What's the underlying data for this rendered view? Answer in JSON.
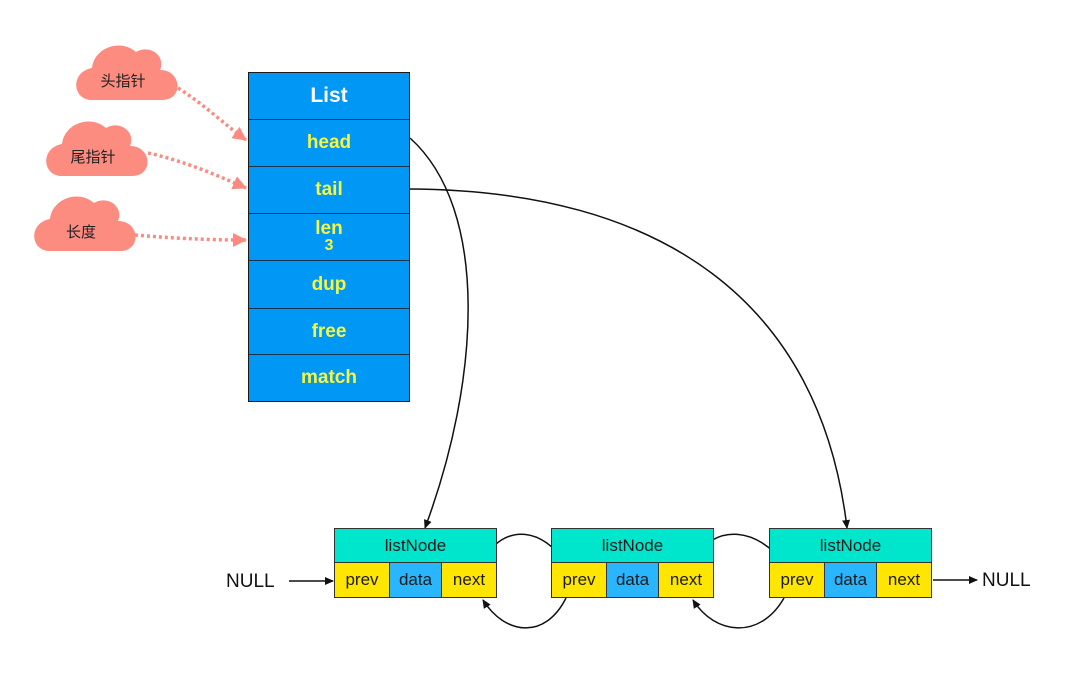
{
  "diagram": {
    "type": "redis-linked-list-structure",
    "colors": {
      "list_fill": "#0097f5",
      "list_title_text": "#ffffff",
      "list_field_text": "#f5f542",
      "cloud_fill": "#fc8b80",
      "pointer_arrow": "#fb8b80",
      "node_header": "#00e6cc",
      "node_pointer_field": "#ffe600",
      "node_data_field": "#29b6ff",
      "edge": "#111111"
    },
    "annotations": [
      {
        "label": "头指针",
        "target": "head"
      },
      {
        "label": "尾指针",
        "target": "tail"
      },
      {
        "label": "长度",
        "target": "len"
      }
    ],
    "list": {
      "title": "List",
      "fields": [
        {
          "name": "head"
        },
        {
          "name": "tail"
        },
        {
          "name": "len",
          "value": "3"
        },
        {
          "name": "dup"
        },
        {
          "name": "free"
        },
        {
          "name": "match"
        }
      ]
    },
    "nodes": [
      {
        "title": "listNode",
        "fields": [
          "prev",
          "data",
          "next"
        ]
      },
      {
        "title": "listNode",
        "fields": [
          "prev",
          "data",
          "next"
        ]
      },
      {
        "title": "listNode",
        "fields": [
          "prev",
          "data",
          "next"
        ]
      }
    ],
    "null_left": "NULL",
    "null_right": "NULL",
    "edges": [
      {
        "from": "list.head",
        "to": "nodes.0"
      },
      {
        "from": "list.tail",
        "to": "nodes.2"
      },
      {
        "from": "nodes.0.next",
        "to": "nodes.1.prev"
      },
      {
        "from": "nodes.1.prev",
        "to": "nodes.0.next"
      },
      {
        "from": "nodes.1.next",
        "to": "nodes.2.prev"
      },
      {
        "from": "nodes.2.prev",
        "to": "nodes.1.next"
      },
      {
        "from": "NULL",
        "to": "nodes.0.prev"
      },
      {
        "from": "nodes.2.next",
        "to": "NULL"
      }
    ]
  }
}
